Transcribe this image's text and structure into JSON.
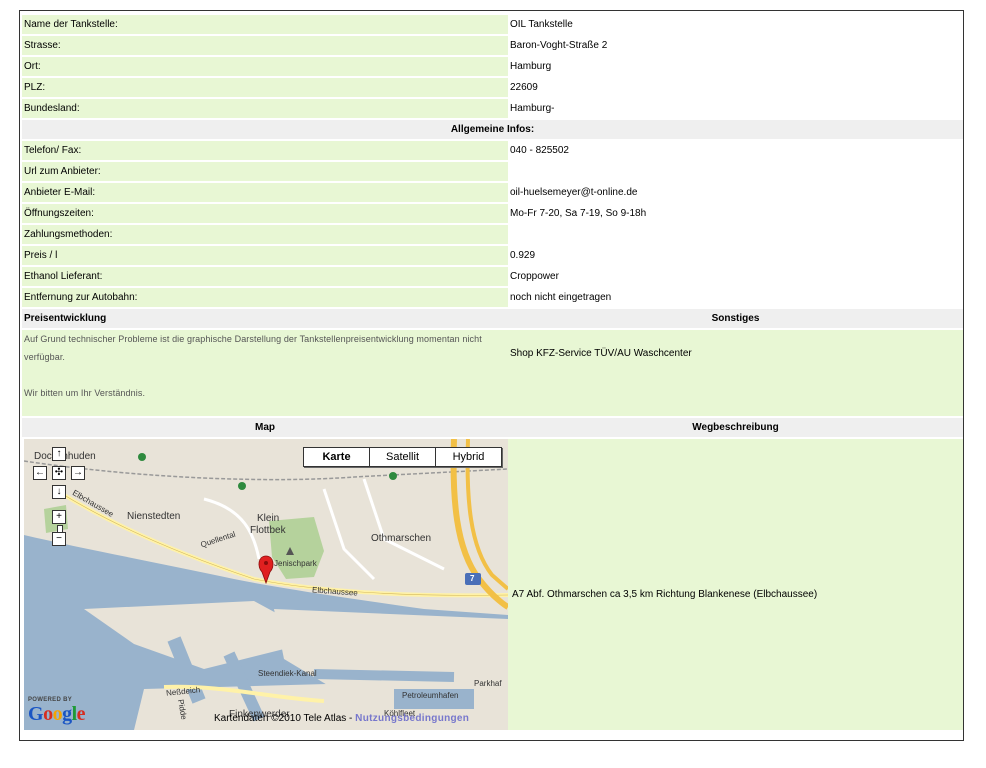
{
  "rows_top": [
    {
      "label": "Name der Tankstelle:",
      "value": "OIL Tankstelle"
    },
    {
      "label": "Strasse:",
      "value": "Baron-Voght-Straße 2"
    },
    {
      "label": "Ort:",
      "value": "Hamburg"
    },
    {
      "label": "PLZ:",
      "value": "22609"
    },
    {
      "label": "Bundesland:",
      "value": "Hamburg-"
    }
  ],
  "section_general": "Allgemeine Infos:",
  "rows_general": [
    {
      "label": "Telefon/ Fax:",
      "value": "040 - 825502"
    },
    {
      "label": "Url zum Anbieter:",
      "value": ""
    },
    {
      "label": "Anbieter E-Mail:",
      "value": "oil-huelsemeyer@t-online.de"
    },
    {
      "label": "Öffnungszeiten:",
      "value": "Mo-Fr 7-20, Sa 7-19, So 9-18h"
    },
    {
      "label": "Zahlungsmethoden:",
      "value": ""
    },
    {
      "label": "Preis / l",
      "value": "0.929"
    },
    {
      "label": "Ethanol Lieferant:",
      "value": "Croppower"
    },
    {
      "label": "Entfernung zur Autobahn:",
      "value": "noch nicht eingetragen"
    }
  ],
  "section_price": "Preisentwicklung",
  "section_other": "Sonstiges",
  "price_note_1": "Auf Grund technischer Probleme ist die graphische Darstellung der Tankstellenpreisentwicklung momentan nicht verfügbar.",
  "price_note_2": "Wir bitten um Ihr Verständnis.",
  "other_text": "Shop KFZ-Service TÜV/AU Waschcenter",
  "section_map": "Map",
  "section_directions": "Wegbeschreibung",
  "directions_text": "A7 Abf. Othmarschen ca 3,5 km Richtung Blankenese (Elbchaussee)",
  "map": {
    "types": [
      "Karte",
      "Satellit",
      "Hybrid"
    ],
    "labels": {
      "dockenhuden": "Dockenhuden",
      "nienstedten": "Nienstedten",
      "klein": "Klein",
      "flottbek": "Flottbek",
      "othmarschen": "Othmarschen",
      "elbchaussee_left": "Elbchaussee",
      "elbchaussee_right": "Elbchaussee",
      "quellental": "Quellental",
      "jenischpark": "Jenischpark",
      "steendiek": "Steendiek-Kanal",
      "petroleum": "Petroleumhafen",
      "parkhaf": "Parkhaf",
      "neßdeich": "Neßdeich",
      "finkenwerder": "Finkenwerder",
      "köhlfleet": "Köhlfleet",
      "pidder": "Pidde",
      "road7": "7"
    },
    "zoom_in": "+",
    "zoom_out": "−",
    "powered_by": "POWERED BY",
    "google": "Google",
    "copyright": "Kartendaten ©2010 Tele Atlas - ",
    "terms": "Nutzungsbedingungen"
  },
  "colors": {
    "label_bg": "#e8f7d4",
    "section_bg": "#efefef",
    "water": "#99b3cc",
    "land": "#e8e3d8",
    "park": "#b5d29c",
    "highway": "#f2c046",
    "pin": "#e02020"
  }
}
